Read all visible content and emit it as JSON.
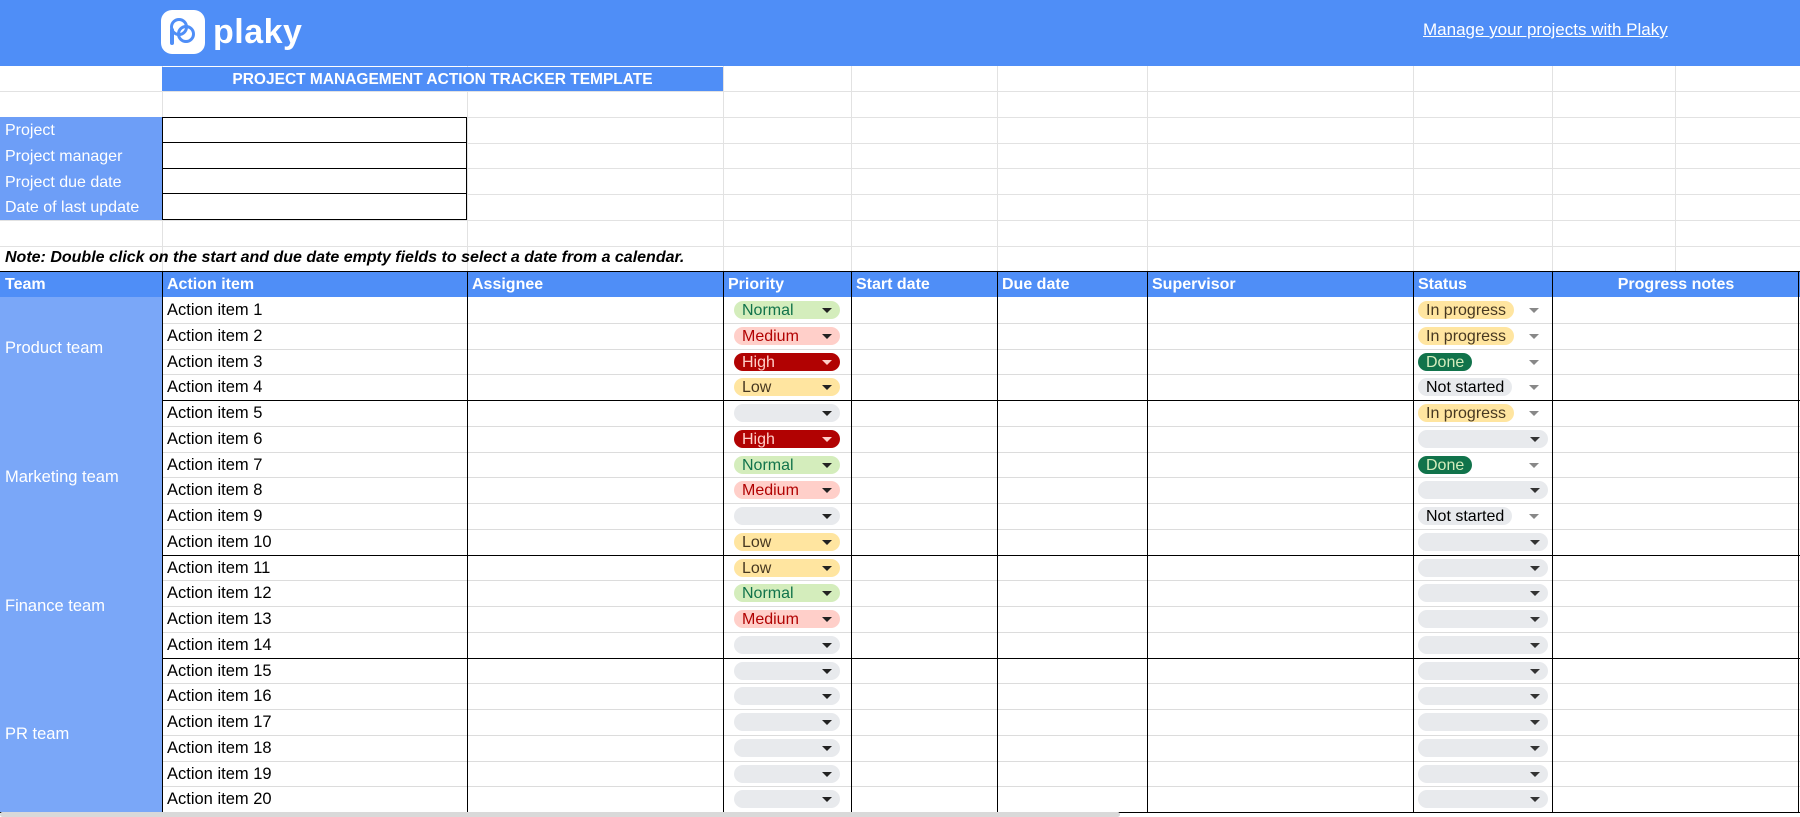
{
  "brand": {
    "name": "plaky",
    "link_text": "Manage your projects with Plaky"
  },
  "sheet_title": "PROJECT MANAGEMENT ACTION TRACKER TEMPLATE",
  "info_fields": [
    {
      "label": "Project",
      "value": ""
    },
    {
      "label": "Project manager",
      "value": ""
    },
    {
      "label": "Project due date",
      "value": ""
    },
    {
      "label": "Date of last update",
      "value": ""
    }
  ],
  "note": "Note: Double click on the start and due date empty fields to select a date from a calendar.",
  "columns": [
    "Team",
    "Action item",
    "Assignee",
    "Priority",
    "Start date",
    "Due date",
    "Supervisor",
    "Status",
    "Progress notes"
  ],
  "priority_colors": {
    "Normal": {
      "bg": "#d4edbc",
      "fg": "#11734b"
    },
    "Medium": {
      "bg": "#ffcfc9",
      "fg": "#b10202"
    },
    "High": {
      "bg": "#b10202",
      "fg": "#ffcfc9"
    },
    "Low": {
      "bg": "#ffe5a0",
      "fg": "#473821"
    },
    "": {
      "bg": "#e8eaed",
      "fg": "#000000"
    }
  },
  "status_colors": {
    "In progress": {
      "bg": "#ffe5a0",
      "fg": "#473821"
    },
    "Done": {
      "bg": "#11734b",
      "fg": "#d4edbc"
    },
    "Not started": {
      "bg": "#e8eaed",
      "fg": "#000000"
    },
    "": {
      "bg": "#e8eaed",
      "fg": "#000000"
    }
  },
  "teams": [
    {
      "name": "Product team",
      "items": [
        {
          "action": "Action item 1",
          "priority": "Normal",
          "status": "In progress"
        },
        {
          "action": "Action item 2",
          "priority": "Medium",
          "status": "In progress"
        },
        {
          "action": "Action item 3",
          "priority": "High",
          "status": "Done"
        },
        {
          "action": "Action item 4",
          "priority": "Low",
          "status": "Not started"
        }
      ]
    },
    {
      "name": "Marketing team",
      "items": [
        {
          "action": "Action item 5",
          "priority": "",
          "status": "In progress"
        },
        {
          "action": "Action item 6",
          "priority": "High",
          "status": ""
        },
        {
          "action": "Action item 7",
          "priority": "Normal",
          "status": "Done"
        },
        {
          "action": "Action item 8",
          "priority": "Medium",
          "status": ""
        },
        {
          "action": "Action item 9",
          "priority": "",
          "status": "Not started"
        },
        {
          "action": "Action item 10",
          "priority": "Low",
          "status": ""
        }
      ]
    },
    {
      "name": "Finance team",
      "items": [
        {
          "action": "Action item 11",
          "priority": "Low",
          "status": ""
        },
        {
          "action": "Action item 12",
          "priority": "Normal",
          "status": ""
        },
        {
          "action": "Action item 13",
          "priority": "Medium",
          "status": ""
        },
        {
          "action": "Action item 14",
          "priority": "",
          "status": ""
        }
      ]
    },
    {
      "name": "PR team",
      "items": [
        {
          "action": "Action item 15",
          "priority": "",
          "status": ""
        },
        {
          "action": "Action item 16",
          "priority": "",
          "status": ""
        },
        {
          "action": "Action item 17",
          "priority": "",
          "status": ""
        },
        {
          "action": "Action item 18",
          "priority": "",
          "status": ""
        },
        {
          "action": "Action item 19",
          "priority": "",
          "status": ""
        },
        {
          "action": "Action item 20",
          "priority": "",
          "status": ""
        }
      ]
    }
  ]
}
